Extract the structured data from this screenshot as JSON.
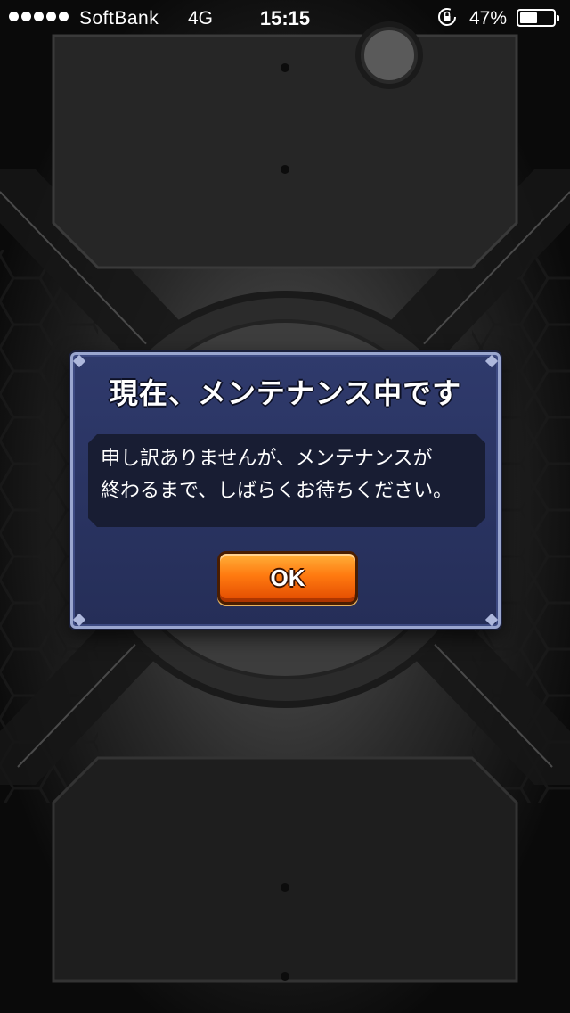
{
  "status_bar": {
    "carrier": "SoftBank",
    "network": "4G",
    "time": "15:15",
    "battery_percent": "47%",
    "icons": [
      "signal-dots-icon",
      "orientation-lock-icon",
      "battery-icon"
    ]
  },
  "dialog": {
    "title": "現在、メンテナンス中です",
    "message_line1": "申し訳ありませんが、メンテナンスが",
    "message_line2": "終わるまで、しばらくお待ちください。",
    "ok_label": "OK"
  },
  "colors": {
    "dialog_bg": "#2b3566",
    "dialog_border": "#9aa6cf",
    "button_orange": "#ff7a10",
    "background": "#1a1a1a"
  }
}
